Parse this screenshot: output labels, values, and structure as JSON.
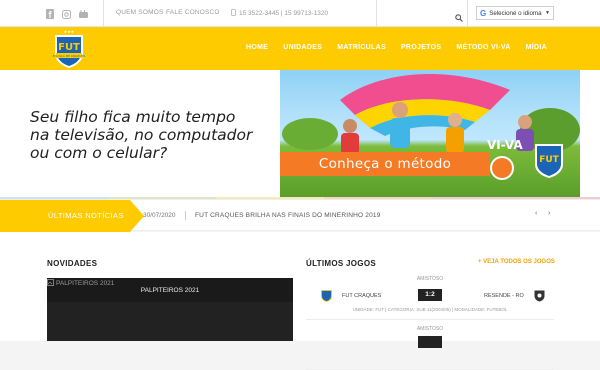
{
  "topbar": {
    "social_icons": [
      "facebook-icon",
      "instagram-icon",
      "youtube-icon"
    ],
    "links": [
      "QUEM SOMOS",
      "FALE CONOSCO"
    ],
    "phones": "15 3522-3445 | 15 99713-1320",
    "language_label": "Selecione o idioma"
  },
  "nav": {
    "items": [
      "HOME",
      "UNIDADES",
      "MATRÍCULAS",
      "PROJETOS",
      "MÉTODO VI-VA",
      "MÍDIA"
    ]
  },
  "logo": {
    "brand": "FUT",
    "sub": "ESCOLA DE CRAQUES"
  },
  "hero": {
    "headline_lines": [
      "Seu filho fica muito tempo",
      "na televisão, no computador",
      "ou com o celular?"
    ],
    "banner_text": "Conheça o método",
    "badge_text": "VI-VA"
  },
  "news": {
    "label": "ÚLTIMAS NOTÍCIAS",
    "date": "30/07/2020",
    "title": "FUT CRAQUES BRILHA NAS FINAIS DO MINERINHO 2019",
    "prev": "‹",
    "next": "›"
  },
  "novidades": {
    "title": "NOVIDADES",
    "video_alt": "PALPITEIROS 2021",
    "video_title": "PALPITEIROS 2021"
  },
  "jogos": {
    "title": "ÚLTIMOS JOGOS",
    "see_all": "+ VEJA TODOS OS JOGOS",
    "games": [
      {
        "kind": "AMISTOSO",
        "home": "FUT CRAQUES",
        "score": "1:2",
        "away": "RESENDE - RO",
        "meta": "UNIDADE: FUT | CATEGORIA: SUB 11(2004/05) | MODALIDADE: FUTEBOL"
      },
      {
        "kind": "AMISTOSO",
        "home": "",
        "score": "",
        "away": "",
        "meta": ""
      }
    ]
  },
  "colors": {
    "brand_yellow": "#fecb00",
    "banner_orange": "#f47a25"
  }
}
